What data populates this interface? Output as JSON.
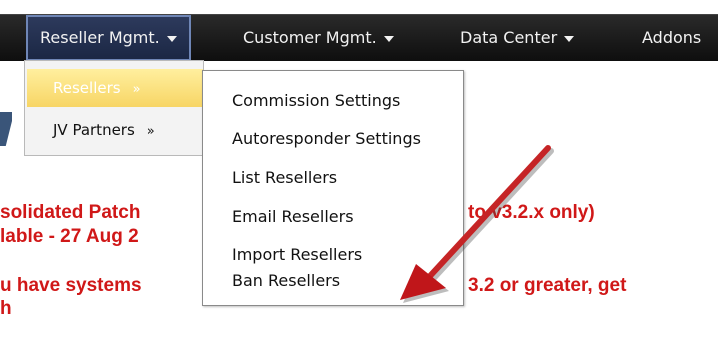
{
  "navbar": {
    "items": [
      {
        "label": "Reseller Mgmt.",
        "has_arrow": true,
        "active": true
      },
      {
        "label": "Customer Mgmt.",
        "has_arrow": true,
        "active": false
      },
      {
        "label": "Data Center",
        "has_arrow": true,
        "active": false
      },
      {
        "label": "Addons",
        "has_arrow": false,
        "active": false
      }
    ]
  },
  "submenu": {
    "items": [
      {
        "label": "Resellers",
        "chevron": "»",
        "highlighted": true
      },
      {
        "label": "JV Partners",
        "chevron": "»",
        "highlighted": false
      }
    ]
  },
  "flyout": {
    "items": [
      {
        "label": "Commission Settings"
      },
      {
        "label": "Autoresponder Settings"
      },
      {
        "label": "List Resellers"
      },
      {
        "label": "Email Resellers"
      },
      {
        "label": "Import Resellers"
      },
      {
        "label": "Ban Resellers"
      }
    ]
  },
  "page": {
    "line1_left": "solidated Patch",
    "line1_right": "to v3.2.x only)",
    "line2_left": "lable - 27 Aug 2",
    "line3_left": "u have systems",
    "line3_right": "3.2 or greater, get",
    "line4_left": "h"
  },
  "colors": {
    "navbar_bg": "#111111",
    "active_bg": "#24304f",
    "highlight": "#f7d565",
    "page_text": "#d01818",
    "annotation_arrow": "#c0161a"
  },
  "annotation": {
    "icon": "red-arrow-icon"
  }
}
